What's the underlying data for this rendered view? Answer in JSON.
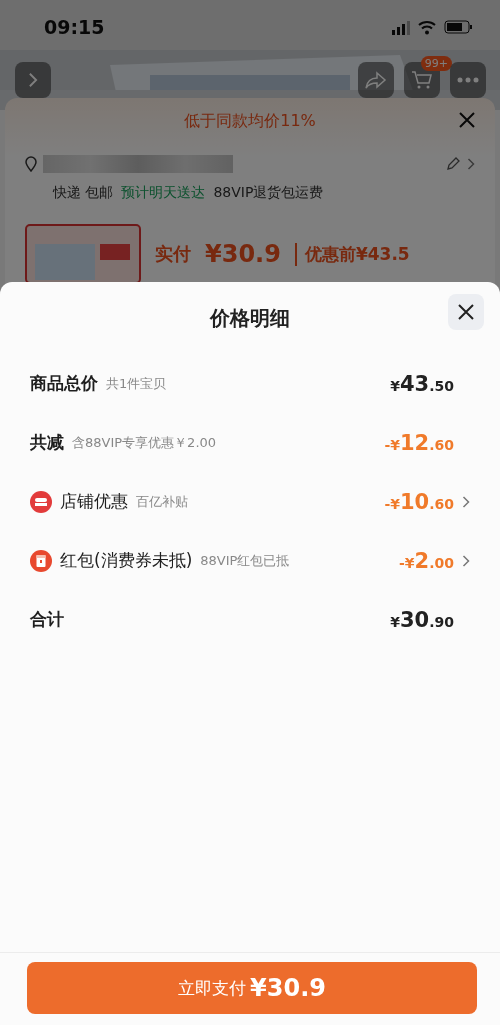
{
  "status_bar": {
    "time": "09:15"
  },
  "top_nav": {
    "cart_badge": "99+"
  },
  "order_sheet": {
    "banner": "低于同款均价11%",
    "delivery": [
      {
        "text": "快递 包邮",
        "kind": "plain"
      },
      {
        "text": "预计明天送达",
        "kind": "highlight"
      },
      {
        "text": "88VIP退货包运费",
        "kind": "plain"
      }
    ],
    "price_label": "实付",
    "price": "¥30.9",
    "original_price": "优惠前¥43.5"
  },
  "price_detail": {
    "title": "价格明细",
    "rows": [
      {
        "kind": "plain",
        "label": "商品总价",
        "note": "共1件宝贝",
        "amount": "¥43.50",
        "discount": false,
        "arrow": false
      },
      {
        "kind": "plain",
        "label": "共减",
        "note": "含88VIP专享优惠￥2.00",
        "amount": "-¥12.60",
        "discount": true,
        "arrow": false
      },
      {
        "kind": "store",
        "label": "店铺优惠",
        "note": "百亿补贴",
        "amount": "-¥10.60",
        "discount": true,
        "arrow": true
      },
      {
        "kind": "packet",
        "label": "红包(消费券未抵)",
        "note": "88VIP红包已抵",
        "amount": "-¥2.00",
        "discount": true,
        "arrow": true
      },
      {
        "kind": "plain",
        "label": "合计",
        "amount": "¥30.90",
        "discount": false,
        "arrow": false
      }
    ],
    "pay_button": {
      "label": "立即支付",
      "amount": "¥30.9"
    }
  }
}
